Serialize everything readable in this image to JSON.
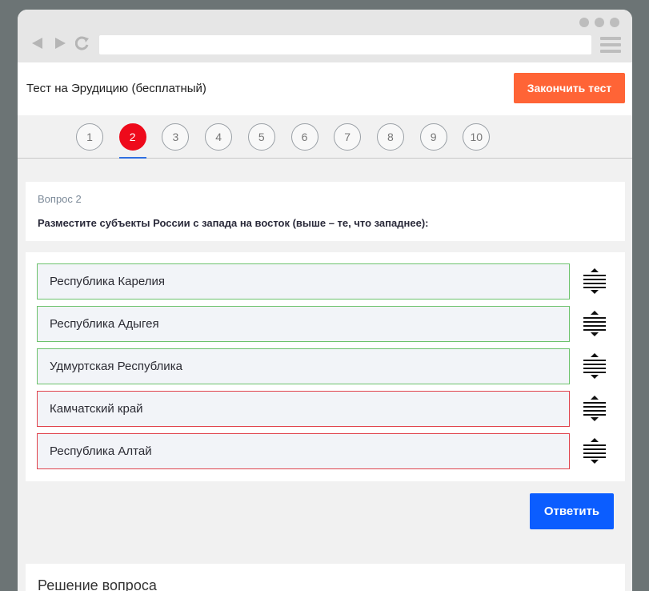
{
  "header": {
    "title": "Тест на Эрудицию (бесплатный)",
    "finish_label": "Закончить тест"
  },
  "steps": [
    "1",
    "2",
    "3",
    "4",
    "5",
    "6",
    "7",
    "8",
    "9",
    "10"
  ],
  "current_step": 2,
  "question": {
    "number": "Вопрос 2",
    "text": "Разместите субъекты России с запада на восток (выше – те, что западнее):"
  },
  "answers": [
    {
      "label": "Республика Карелия",
      "status": "correct"
    },
    {
      "label": "Республика Адыгея",
      "status": "correct"
    },
    {
      "label": "Удмуртская Республика",
      "status": "correct"
    },
    {
      "label": "Камчатский край",
      "status": "wrong"
    },
    {
      "label": "Республика Алтай",
      "status": "wrong"
    }
  ],
  "submit_label": "Ответить",
  "solution": {
    "title": "Решение вопроса"
  },
  "colors": {
    "finish": "#ff6436",
    "submit": "#0b5dff",
    "active_step": "#ee0a1b",
    "correct": "#6cc26c",
    "wrong": "#e0424c"
  },
  "icons": {
    "drag": "drag-handle-icon",
    "back": "back-arrow-icon",
    "forward": "forward-arrow-icon",
    "reload": "reload-icon",
    "menu": "hamburger-menu-icon"
  }
}
